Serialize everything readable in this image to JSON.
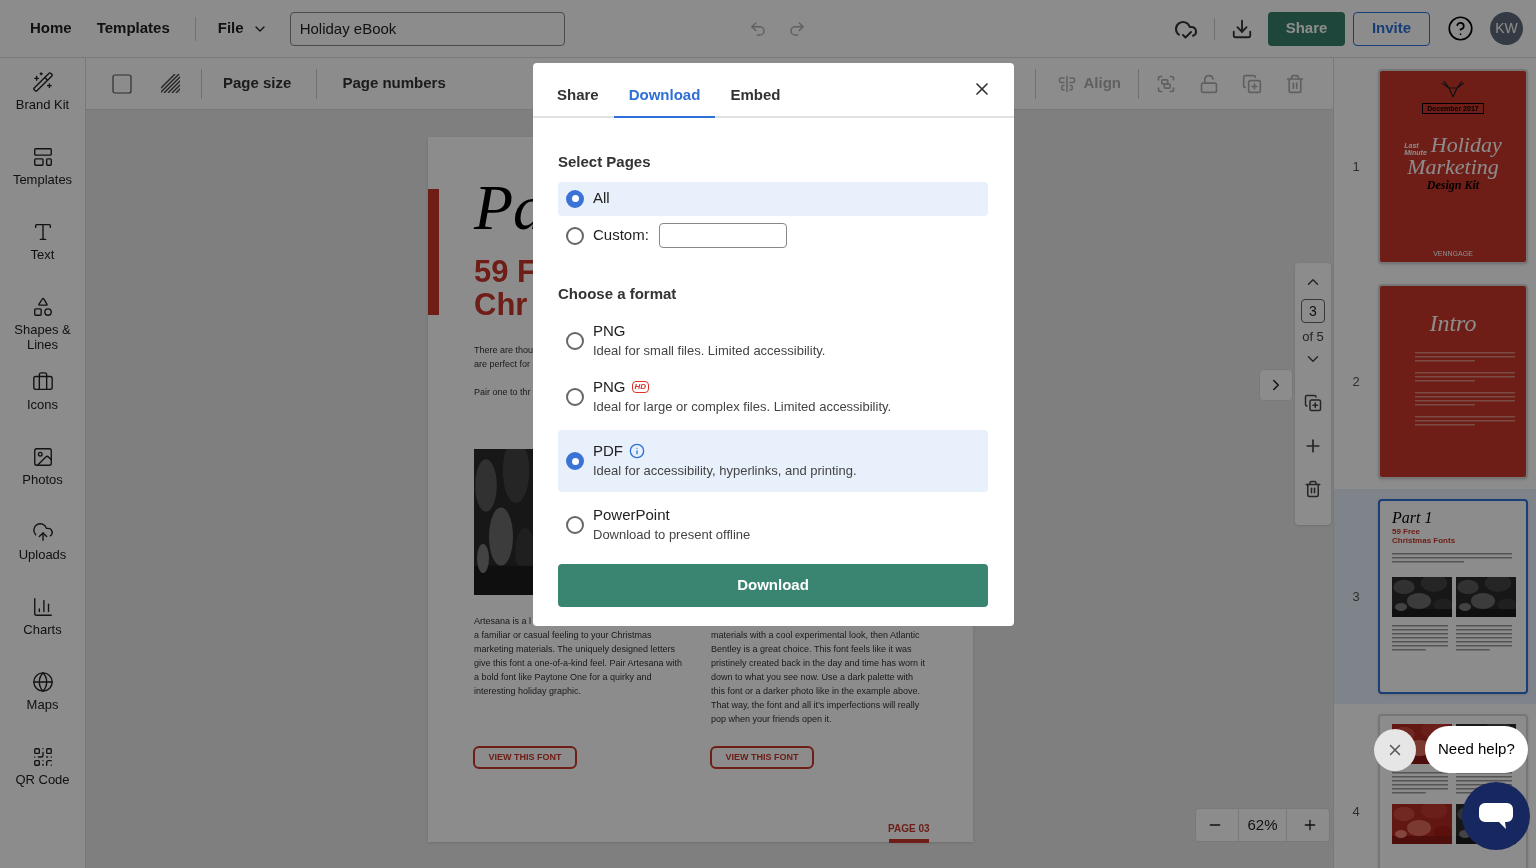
{
  "topbar": {
    "nav": [
      {
        "label": "Home"
      },
      {
        "label": "Templates"
      }
    ],
    "file_menu": "File",
    "document_title": "Holiday eBook",
    "undo": {
      "disabled": true
    },
    "redo": {
      "disabled": true
    },
    "share": "Share",
    "invite": "Invite",
    "avatar": "KW"
  },
  "sidebar": {
    "items": [
      {
        "label": "Brand Kit"
      },
      {
        "label": "Templates"
      },
      {
        "label": "Text"
      },
      {
        "label": "Shapes & Lines"
      },
      {
        "label": "Icons"
      },
      {
        "label": "Photos"
      },
      {
        "label": "Uploads"
      },
      {
        "label": "Charts"
      },
      {
        "label": "Maps"
      },
      {
        "label": "QR Code"
      }
    ]
  },
  "toolbar": {
    "page_size": "Page size",
    "page_numbers": "Page numbers",
    "align": {
      "label": "Align",
      "disabled": true
    }
  },
  "page": {
    "heading": "Pa",
    "subheading_lines": [
      "59 F",
      "Chr"
    ],
    "intro_lines": [
      "There are thou",
      "are perfect for"
    ],
    "pair_line": "Pair one to thr",
    "left_first_line": "Artesana is a l",
    "left_body": "a familiar or casual feeling to your Christmas marketing materials. The uniquely designed letters give this font a one-of-a-kind feel. Pair Artesana with a bold font like Paytone One for a quirky and interesting holiday graphic.",
    "right_body": "materials with a cool experimental look, then Atlantic Bentley is a great choice. This font feels like it was pristinely created back in the day and time has worn it down to what you see now. Use a dark palette with this font or a darker photo like in the example above. That way, the font and all it’s imperfections will really pop when your friends open it.",
    "buttons": [
      "VIEW THIS FONT",
      "VIEW THIS FONT"
    ],
    "page_label": "PAGE 03"
  },
  "page_nav": {
    "current": "3",
    "total": "of 5"
  },
  "zoom": {
    "level_text": "62%"
  },
  "thumbnails": [
    {
      "number": "1",
      "selected": false,
      "kind": "cover",
      "texts": [
        "December 2017",
        "Last",
        "Minute",
        "Holiday",
        "Marketing",
        "Design Kit",
        "VENNGAGE"
      ]
    },
    {
      "number": "2",
      "selected": false,
      "kind": "intro",
      "texts": [
        "Intro"
      ]
    },
    {
      "number": "3",
      "selected": true,
      "kind": "fonts",
      "texts": [
        "Part 1",
        "59 Free",
        "Christmas Fonts"
      ]
    },
    {
      "number": "4",
      "selected": false,
      "kind": "fonts_more"
    }
  ],
  "dialog": {
    "tabs": [
      {
        "label": "Share",
        "selected": false
      },
      {
        "label": "Download",
        "selected": true
      },
      {
        "label": "Embed",
        "selected": false
      }
    ],
    "pages_title": "Select Pages",
    "page_options": [
      {
        "label": "All",
        "kind": "plain",
        "selected": true
      },
      {
        "label": "Custom:",
        "kind": "input",
        "selected": false
      }
    ],
    "format_title": "Choose a format",
    "formats": [
      {
        "label": "PNG",
        "description": "Ideal for small files. Limited accessibility.",
        "selected": false
      },
      {
        "label": "PNG",
        "badge": "HD",
        "description": "Ideal for large or complex files. Limited accessibility.",
        "selected": false
      },
      {
        "label": "PDF",
        "info": true,
        "description": "Ideal for accessibility, hyperlinks, and printing.",
        "selected": true
      },
      {
        "label": "PowerPoint",
        "description": "Download to present offline",
        "selected": false
      }
    ],
    "button": "Download"
  },
  "help": {
    "bubble": "Need help?"
  }
}
